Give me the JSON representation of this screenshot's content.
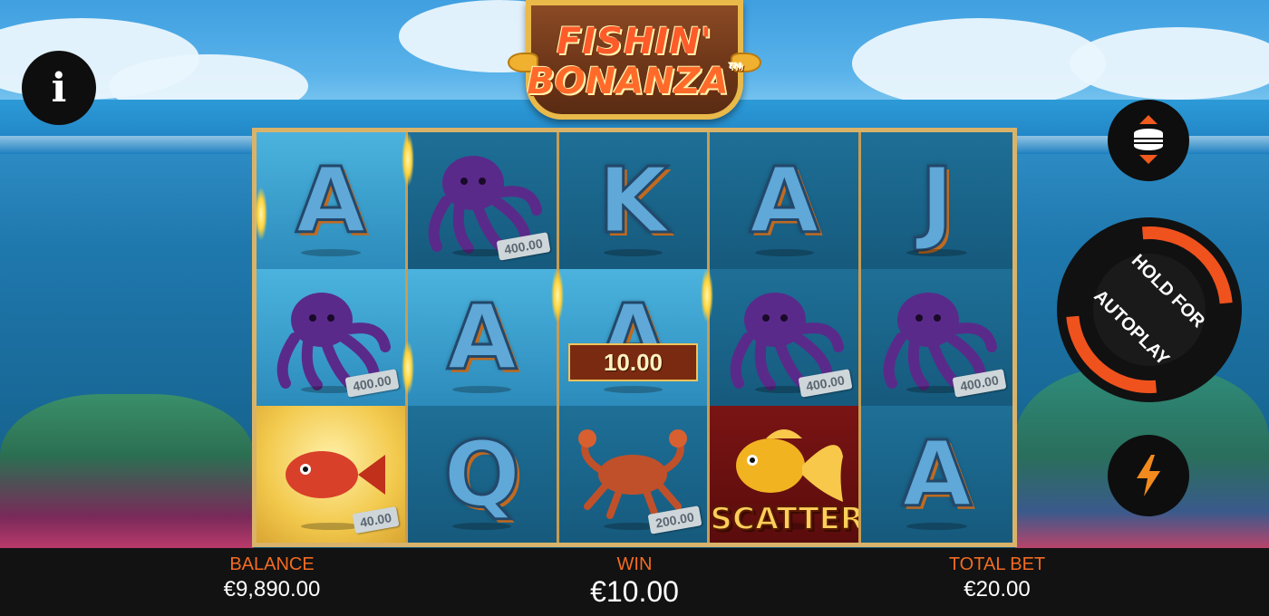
{
  "logo": {
    "line1": "FISHIN'",
    "line2": "BONANZA",
    "tm": "TM"
  },
  "info_button": {
    "label": "i"
  },
  "colors": {
    "accent": "#f26b22",
    "frame": "#d9b36a",
    "bar": "#121212",
    "autoplay_ring": "#f0521e"
  },
  "reels": [
    [
      {
        "symbol": "A",
        "type": "letter",
        "state": "win"
      },
      {
        "symbol": "octopus",
        "type": "fish",
        "state": "dim",
        "value": "400.00"
      },
      {
        "symbol": "K",
        "type": "letter",
        "state": "dim"
      },
      {
        "symbol": "A",
        "type": "letter",
        "state": "dim"
      },
      {
        "symbol": "J",
        "type": "letter",
        "state": "dim"
      }
    ],
    [
      {
        "symbol": "octopus",
        "type": "fish",
        "state": "win",
        "value": "400.00"
      },
      {
        "symbol": "A",
        "type": "letter",
        "state": "win"
      },
      {
        "symbol": "A",
        "type": "letter",
        "state": "win",
        "win_amount": "10.00"
      },
      {
        "symbol": "octopus",
        "type": "fish",
        "state": "dim",
        "value": "400.00"
      },
      {
        "symbol": "octopus",
        "type": "fish",
        "state": "dim",
        "value": "400.00"
      }
    ],
    [
      {
        "symbol": "red-fish",
        "type": "fish",
        "state": "gold",
        "value": "40.00"
      },
      {
        "symbol": "Q",
        "type": "letter",
        "state": "dim"
      },
      {
        "symbol": "crab",
        "type": "fish",
        "state": "dim",
        "value": "200.00"
      },
      {
        "symbol": "goldfish",
        "type": "scatter",
        "state": "scatter",
        "label": "SCATTER"
      },
      {
        "symbol": "A",
        "type": "letter",
        "state": "dim"
      }
    ]
  ],
  "controls": {
    "stake_icon": "coin-stack-icon",
    "autoplay_line1": "HOLD FOR",
    "autoplay_line2": "AUTOPLAY",
    "turbo_icon": "lightning-icon"
  },
  "bottom_bar": {
    "balance_label": "BALANCE",
    "balance_value": "€9,890.00",
    "win_label": "WIN",
    "win_value": "€10.00",
    "total_bet_label": "TOTAL BET",
    "total_bet_value": "€20.00"
  }
}
